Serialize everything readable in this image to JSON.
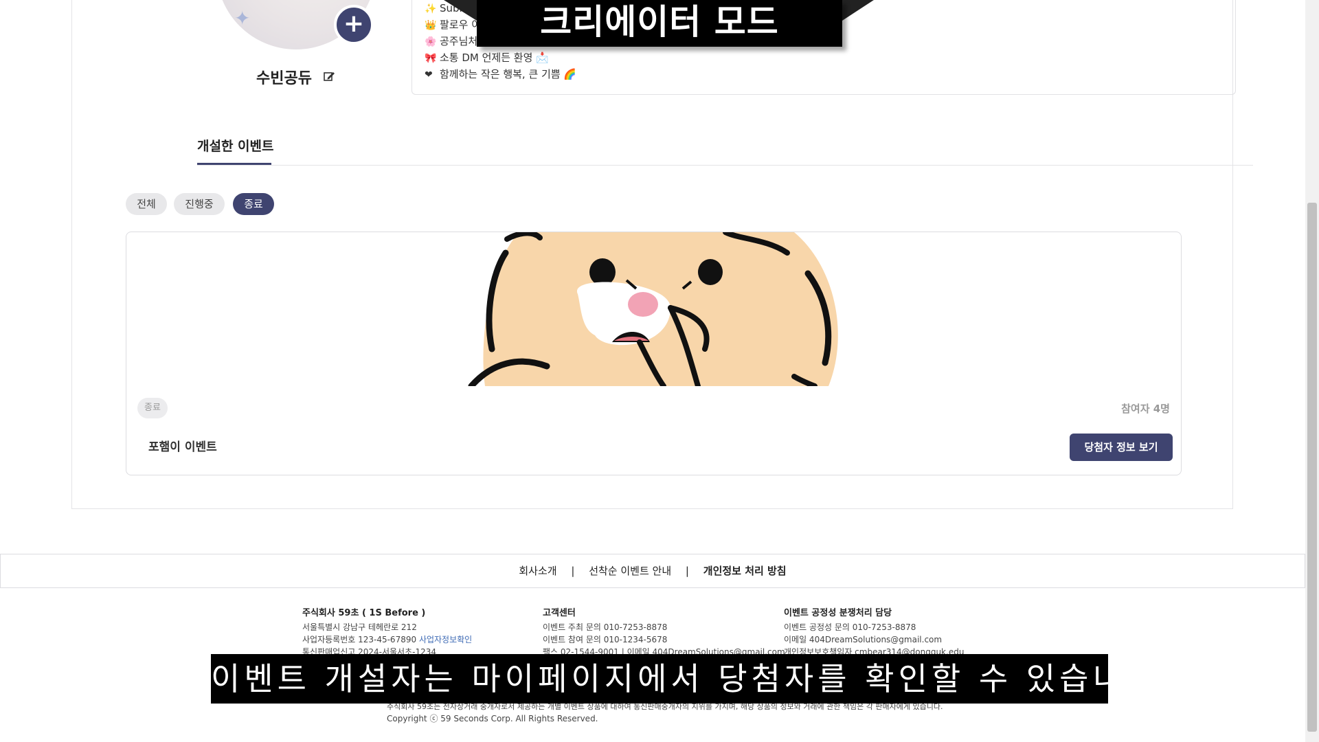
{
  "banner": {
    "title": "크리에이터 모드"
  },
  "profile": {
    "nickname": "수빈공듀",
    "add_label": "+",
    "bio_lines": [
      {
        "icon": "✨",
        "text": "Subin 공듀 ✨"
      },
      {
        "icon": "👑",
        "text": "팔로우 이벤트 중! 🎁"
      },
      {
        "icon": "🌸",
        "text": "공주님처럼 특별한 순간을 만들어 드려요"
      },
      {
        "icon": "🎀",
        "text": "소통 DM 언제든 환영 📩"
      },
      {
        "icon": "❤",
        "text": "함께하는 작은 행복, 큰 기쁨 🌈"
      }
    ]
  },
  "events_section": {
    "title": "개설한 이벤트",
    "filters": [
      "전체",
      "진행중",
      "종료"
    ],
    "active_filter": "종료"
  },
  "event_card": {
    "status": "종료",
    "participants": "참여자 4명",
    "name": "포햄이 이벤트",
    "winners_button": "당첨자 정보 보기"
  },
  "footer": {
    "nav": [
      "회사소개",
      "선착순 이벤트 안내",
      "개인정보 처리 방침"
    ],
    "separator": "|",
    "company": {
      "title": "주식회사 59초 ( 1S Before )",
      "address": "서울특별시 강남구 테헤란로 212",
      "biz_no": "사업자등록번호 123-45-67890",
      "biz_link": "사업자정보확인",
      "ecommerce": "통신판매업신고 2024-서울서초-1234"
    },
    "support": {
      "title": "고객센터",
      "line1": "이벤트 주최 문의 010-7253-8878",
      "line2": "이벤트 참여 문의 010-1234-5678",
      "line3": "팩스 02-1544-9001 | 이메일 404DreamSolutions@gmail.com"
    },
    "dispute": {
      "title": "이벤트 공정성 분쟁처리 담당",
      "line1": "이벤트 공정성 문의 010-7253-8878",
      "line2": "이메일 404DreamSolutions@gmail.com",
      "line3": "개인정보보호책임자 cmbear314@dongguk.edu"
    },
    "disclaimer": "주식회사 59초는 전자상거래 중개자로서 제공하는 개별 이벤트 상품에 대하여 통신판매중개자의 지위를 가지며, 해당 상품의 정보와 거래에 관한 책임은 각 판매자에게 있습니다.",
    "copyright": "Copyright ⓒ 59 Seconds Corp. All Rights Reserved."
  },
  "subtitle": "이벤트 개설자는 마이페이지에서 당첨자를 확인할 수 있습니다."
}
